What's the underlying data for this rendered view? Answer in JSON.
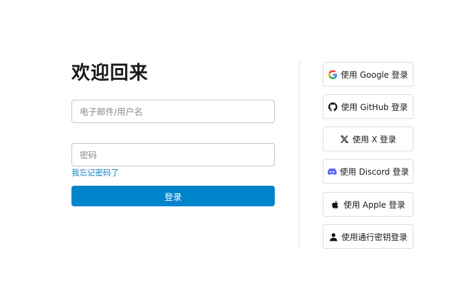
{
  "form": {
    "title": "欢迎回来",
    "email_placeholder": "电子邮件/用户名",
    "password_placeholder": "密码",
    "forgot_link": "我忘记密码了",
    "submit_label": "登录"
  },
  "social_logins": [
    {
      "label": "使用 Google 登录",
      "icon": "google-icon"
    },
    {
      "label": "使用 GitHub 登录",
      "icon": "github-icon"
    },
    {
      "label": "使用 X 登录",
      "icon": "x-icon"
    },
    {
      "label": "使用 Discord 登录",
      "icon": "discord-icon"
    },
    {
      "label": "使用 Apple 登录",
      "icon": "apple-icon"
    },
    {
      "label": "使用通行密钥登录",
      "icon": "person-icon"
    }
  ],
  "colors": {
    "primary": "#0085cc",
    "link": "#0f7fc4",
    "discord": "#5865f2"
  }
}
